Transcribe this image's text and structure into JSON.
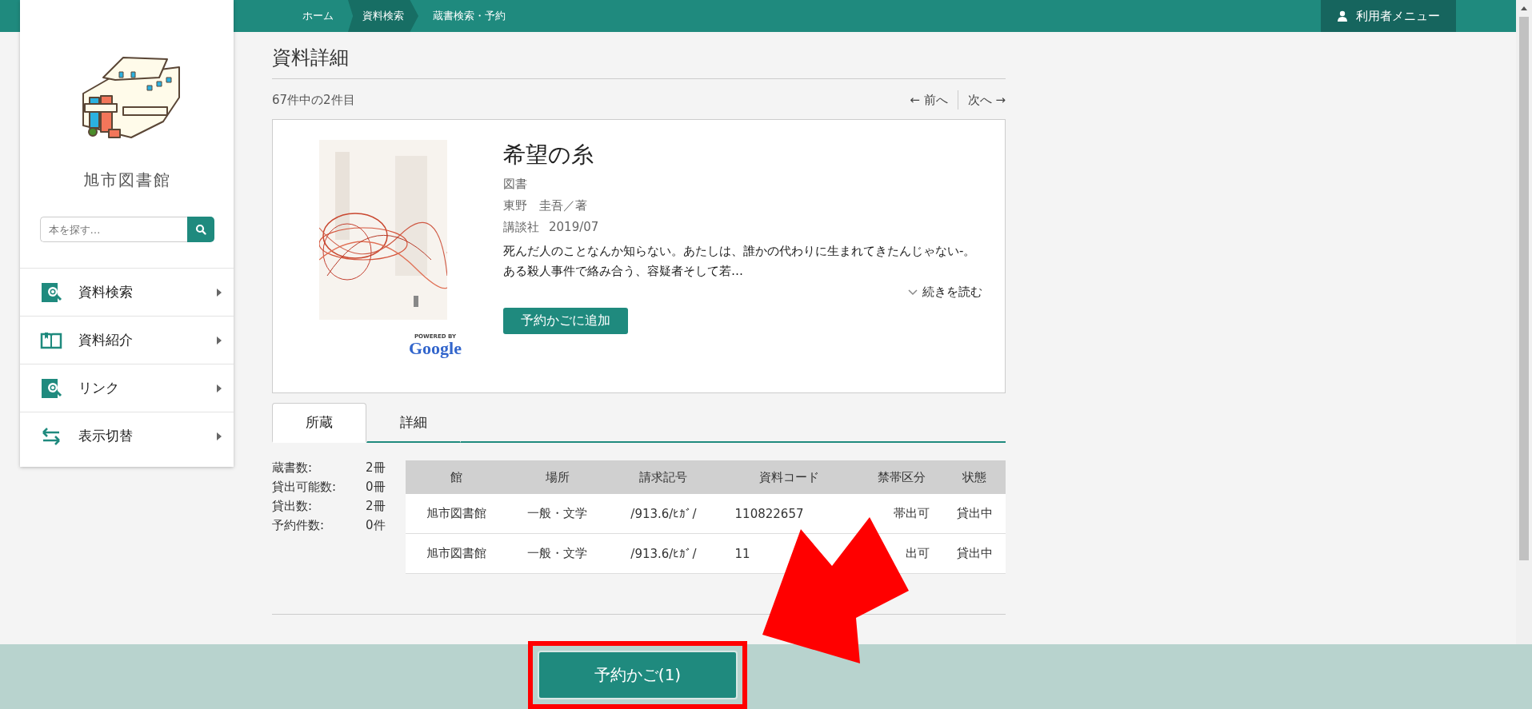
{
  "breadcrumb": [
    {
      "label": "ホーム",
      "selected": false
    },
    {
      "label": "資料検索",
      "selected": true
    },
    {
      "label": "蔵書検索・予約",
      "selected": false
    }
  ],
  "user_menu": "利用者メニュー",
  "sidebar": {
    "library_name": "旭市図書館",
    "search": {
      "placeholder": "本を探す…"
    },
    "items": [
      {
        "label": "資料検索",
        "kind": "search"
      },
      {
        "label": "資料紹介",
        "kind": "book"
      },
      {
        "label": "リンク",
        "kind": "search"
      },
      {
        "label": "表示切替",
        "kind": "swap"
      }
    ]
  },
  "page_title": "資料詳細",
  "position": "67件中の2件目",
  "prev": "← 前へ",
  "next": "次へ →",
  "book": {
    "title": "希望の糸",
    "type": "図書",
    "author": "東野　圭吾／著",
    "publisher": "講談社",
    "date": "2019/07",
    "summary": "死んだ人のことなんか知らない。あたしは、誰かの代わりに生まれてきたんじゃない-。ある殺人事件で絡み合う、容疑者そして若…",
    "read_more": "続きを読む",
    "add_button": "予約かごに追加",
    "powered_by": "POWERED BY",
    "logo": "Google"
  },
  "tabs": [
    {
      "label": "所蔵",
      "selected": true
    },
    {
      "label": "詳細",
      "selected": false
    }
  ],
  "stats": [
    {
      "label": "蔵書数:",
      "value": "2冊"
    },
    {
      "label": "貸出可能数:",
      "value": "0冊"
    },
    {
      "label": "貸出数:",
      "value": "2冊"
    },
    {
      "label": "予約件数:",
      "value": "0件"
    }
  ],
  "table": {
    "columns": [
      "館",
      "場所",
      "請求記号",
      "資料コード",
      "禁帯区分",
      "状態"
    ],
    "rows": [
      [
        "旭市図書館",
        "一般・文学",
        "/913.6/ﾋｶﾞ/",
        "110822657",
        "帯出可",
        "貸出中"
      ],
      [
        "旭市図書館",
        "一般・文学",
        "/913.6/ﾋｶﾞ/",
        "11",
        "出可",
        "貸出中"
      ]
    ]
  },
  "basket_button": "予約かご(1)"
}
